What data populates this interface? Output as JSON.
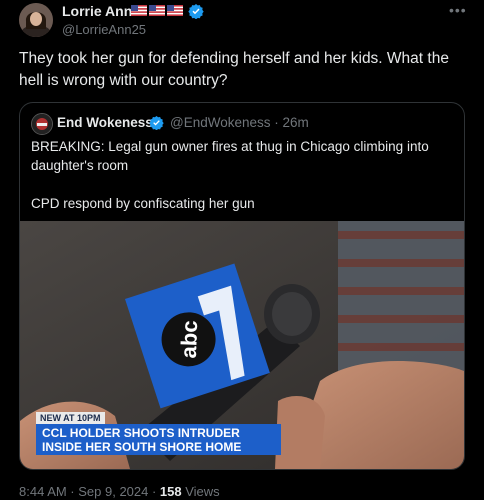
{
  "tweet": {
    "author_name": "Lorrie Ann",
    "author_handle": "@LorrieAnn25",
    "text": "They took her gun for defending herself and her kids. What the hell is wrong with our country?",
    "more_icon": "more-dots-icon",
    "timestamp": "8:44 AM · Sep 9, 2024 · ",
    "views_count": "158",
    "views_label": " Views"
  },
  "quote": {
    "author_name": "End Wokeness",
    "author_handle": "@EndWokeness · 26m",
    "line1": "BREAKING: Legal gun owner fires at thug in Chicago climbing into daughter's room",
    "line2": "CPD respond by confiscating her gun",
    "media": {
      "tag": "NEW AT 10PM",
      "headline_line1": "CCL HOLDER SHOOTS INTRUDER",
      "headline_line2": "INSIDE HER SOUTH SHORE HOME"
    }
  },
  "colors": {
    "background": "#000000",
    "text": "#e7e9ea",
    "muted": "#71767b",
    "verified": "#1d9bf0",
    "abc_blue": "#1d5fc9"
  }
}
